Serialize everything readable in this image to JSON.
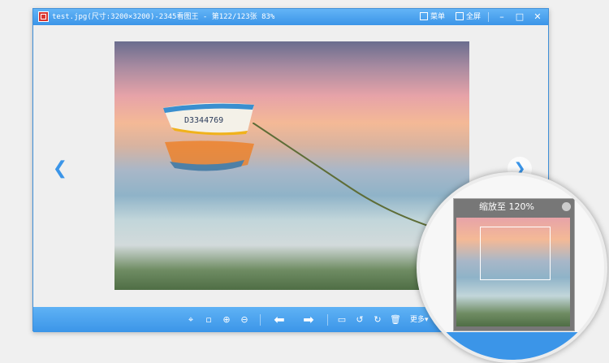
{
  "window": {
    "title": "test.jpg(尺寸:3200×3200)-2345看图王 - 第122/123张 83%",
    "menu_label": "菜单",
    "fullscreen_label": "全屏"
  },
  "toolbar": {
    "more_label": "更多"
  },
  "zoom_panel": {
    "label": "缩放至 120%"
  },
  "colors": {
    "accent": "#3b95e8",
    "title_bar": "#4ea6f2"
  },
  "icons": [
    "app-icon",
    "menu-icon",
    "fullscreen-icon",
    "minimize-icon",
    "maximize-icon",
    "close-icon",
    "chevron-left-icon",
    "chevron-right-icon",
    "fit-window-icon",
    "actual-size-icon",
    "zoom-in-icon",
    "zoom-out-icon",
    "previous-arrow-icon",
    "next-arrow-icon",
    "comment-icon",
    "rotate-left-icon",
    "rotate-right-icon",
    "delete-icon"
  ]
}
